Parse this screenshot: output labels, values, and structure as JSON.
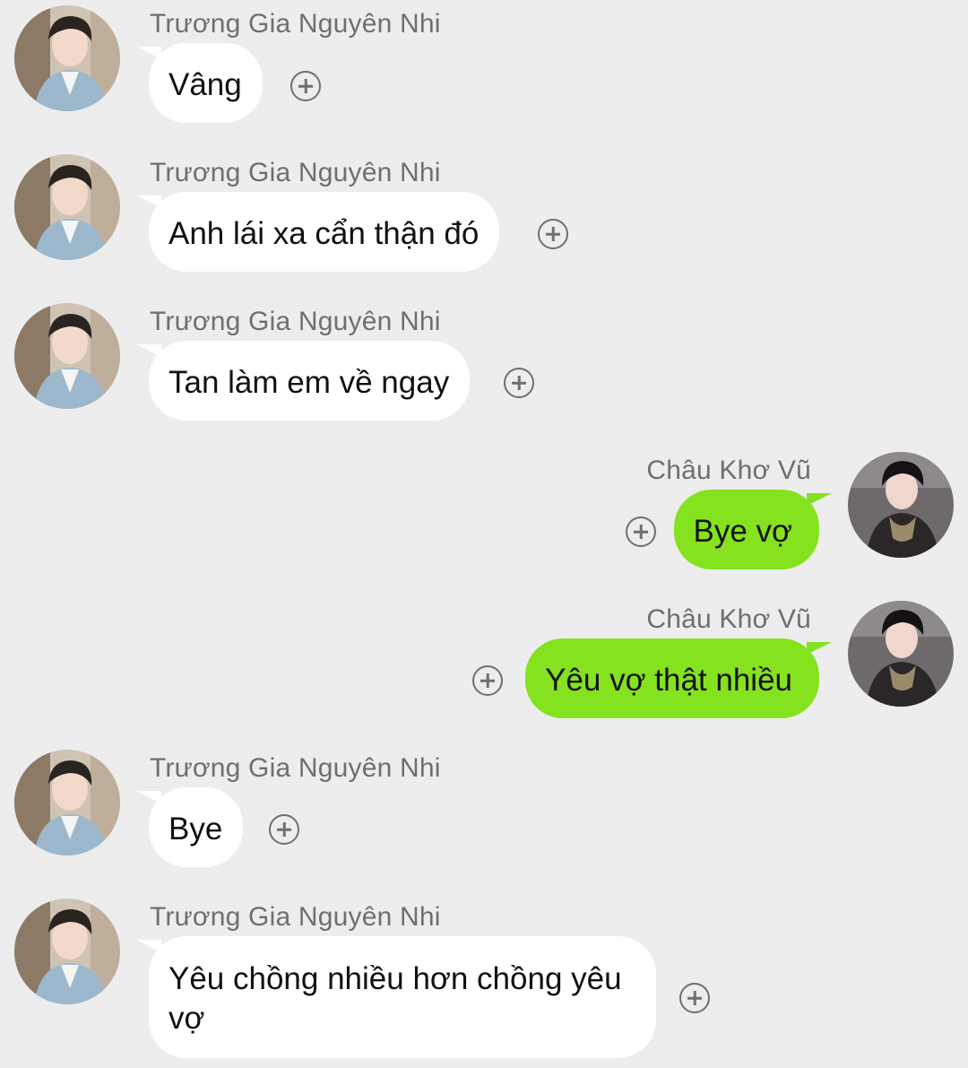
{
  "messages": [
    {
      "sender": "Trương Gia Nguyên Nhi",
      "text": "Vâng",
      "side": "left"
    },
    {
      "sender": "Trương Gia Nguyên Nhi",
      "text": "Anh lái xa cẩn thận đó",
      "side": "left"
    },
    {
      "sender": "Trương Gia Nguyên Nhi",
      "text": "Tan làm em về ngay",
      "side": "left"
    },
    {
      "sender": "Châu Khơ Vũ",
      "text": "Bye vợ",
      "side": "right"
    },
    {
      "sender": "Châu Khơ Vũ",
      "text": "Yêu vợ thật nhiều",
      "side": "right"
    },
    {
      "sender": "Trương Gia Nguyên Nhi",
      "text": "Bye",
      "side": "left"
    },
    {
      "sender": "Trương Gia Nguyên Nhi",
      "text": "Yêu chồng nhiều hơn chồng yêu vợ",
      "side": "left"
    }
  ],
  "colors": {
    "background": "#ededed",
    "incoming_bubble": "#ffffff",
    "outgoing_bubble": "#85e21f",
    "name_text": "#6f6f6f"
  },
  "icons": {
    "reaction": "add-reaction-icon",
    "avatar_left": "avatar-photo",
    "avatar_right": "avatar-photo"
  }
}
